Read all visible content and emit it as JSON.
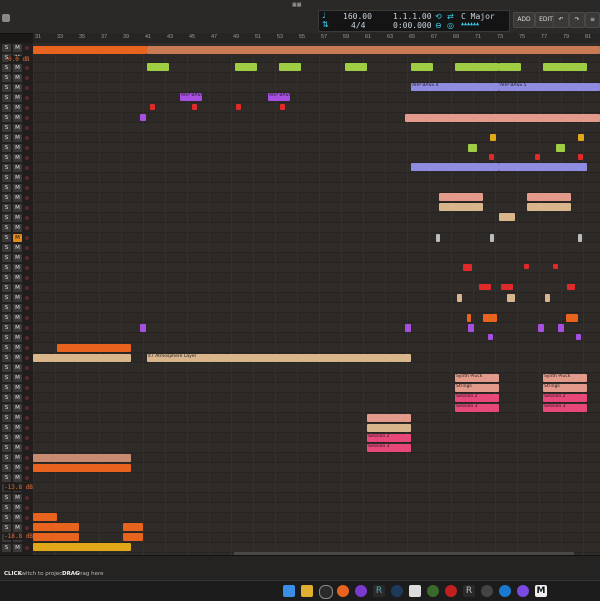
{
  "transport": {
    "tempo": "160.00",
    "time_signature": "4/4",
    "position_bars": "1.1.1.00",
    "position_time": "0:00.000",
    "key": "C Major",
    "key_sub": "▲▲▲▲▲▲"
  },
  "toolbar": {
    "add_label": "ADD",
    "edit_label": "EDIT"
  },
  "ruler": {
    "numbers": [
      "31",
      "33",
      "35",
      "37",
      "39",
      "41",
      "43",
      "45",
      "47",
      "49",
      "51",
      "53",
      "55",
      "57",
      "59",
      "61",
      "63",
      "65",
      "67",
      "69",
      "71",
      "73",
      "75",
      "77",
      "79",
      "81"
    ]
  },
  "tracks": {
    "solo_label": "S",
    "mute_label": "M",
    "volume_tag_1": "0.0 dB",
    "volume_tag_2": "-13.8 dB",
    "volume_tag_3": "-18.8 dB"
  },
  "clips": {
    "arp_bass": "ARP BASS 1",
    "arp_bass_4": "ARP BASS 4",
    "arp_bass_5": "ARP BASS 5",
    "atmosphere": "47 Atmosphere Layer",
    "synth_pluck": "Synth Pluck",
    "strings": "Strings",
    "session": "Session 2",
    "session_3": "Session 3"
  },
  "status": {
    "click_hint_key": "CLICK",
    "click_hint": "Switch to project",
    "drag_hint_key": "DRAG",
    "drag_hint": "Drag here"
  },
  "colors": {
    "accent_orange": "#e8641e",
    "lime": "#9fce45",
    "lavender": "#8f8be0",
    "salmon": "#e39a8a",
    "pink": "#e8477a",
    "tan": "#d8b58a",
    "purple": "#a64fe0",
    "red": "#e02a2a",
    "yellow": "#e0a818"
  }
}
